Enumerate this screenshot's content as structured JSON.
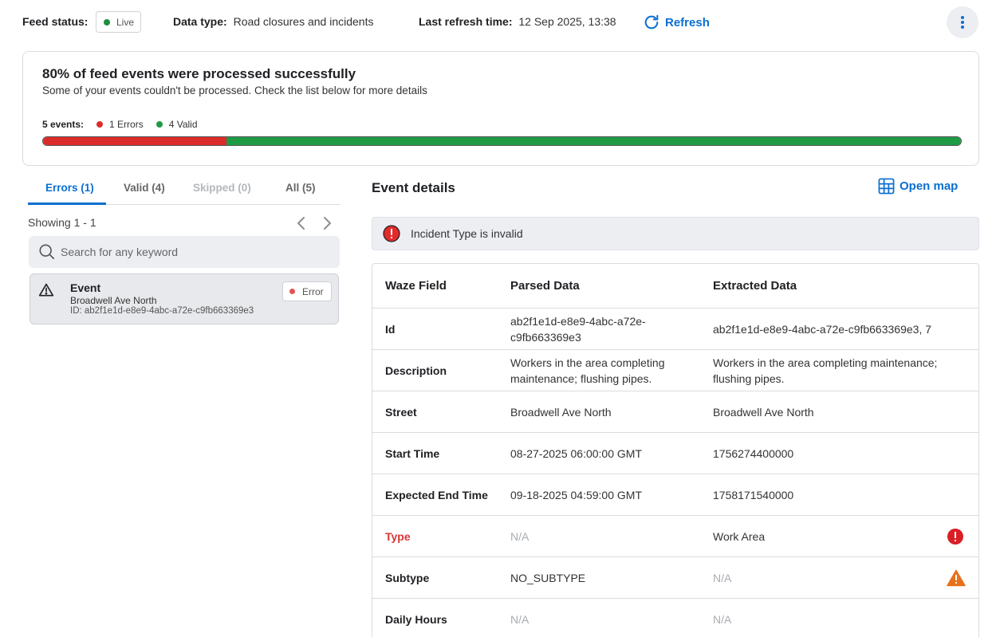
{
  "topbar": {
    "feed_status_label": "Feed status:",
    "feed_status_value": "Live",
    "data_type_label": "Data type:",
    "data_type_value": "Road closures and incidents",
    "last_refresh_label": "Last refresh time:",
    "last_refresh_value": "12 Sep 2025, 13:38",
    "refresh_label": "Refresh"
  },
  "summary": {
    "title": "80% of feed events were processed successfully",
    "subtitle": "Some of your events couldn't be processed. Check the list below for more details",
    "events_label": "5 events:",
    "errors_label": "1 Errors",
    "valid_label": "4 Valid",
    "error_fraction": 0.2,
    "error_color": "#dc2b2b",
    "valid_color": "#1f9a45"
  },
  "tabs": [
    {
      "label": "Errors (1)",
      "state": "active"
    },
    {
      "label": "Valid (4)",
      "state": "normal"
    },
    {
      "label": "Skipped (0)",
      "state": "disabled"
    },
    {
      "label": "All (5)",
      "state": "normal"
    }
  ],
  "list": {
    "showing": "Showing 1 - 1",
    "search_placeholder": "Search for any keyword",
    "events": [
      {
        "title": "Event",
        "street": "Broadwell Ave North",
        "id_text": "ID: ab2f1e1d-e8e9-4abc-a72e-c9fb663369e3",
        "badge": "Error"
      }
    ]
  },
  "details": {
    "title": "Event details",
    "open_map_label": "Open map",
    "alert_text": "Incident Type is invalid",
    "columns": [
      "Waze Field",
      "Parsed Data",
      "Extracted Data"
    ],
    "rows": [
      {
        "field": "Id",
        "parsed": "ab2f1e1d-e8e9-4abc-a72e-c9fb663369e3",
        "extracted": "ab2f1e1d-e8e9-4abc-a72e-c9fb663369e3, 7",
        "status": ""
      },
      {
        "field": "Description",
        "parsed": "Workers in the area completing maintenance; flushing pipes.",
        "extracted": "Workers in the area completing maintenance; flushing pipes.",
        "status": ""
      },
      {
        "field": "Street",
        "parsed": "Broadwell Ave North",
        "extracted": "Broadwell Ave North",
        "status": ""
      },
      {
        "field": "Start Time",
        "parsed": "08-27-2025 06:00:00 GMT",
        "extracted": "1756274400000",
        "status": ""
      },
      {
        "field": "Expected End Time",
        "parsed": "09-18-2025 04:59:00 GMT",
        "extracted": "1758171540000",
        "status": ""
      },
      {
        "field": "Type",
        "parsed": "N/A",
        "extracted": "Work Area",
        "status": "error"
      },
      {
        "field": "Subtype",
        "parsed": "NO_SUBTYPE",
        "extracted": "N/A",
        "status": "warning"
      },
      {
        "field": "Daily Hours",
        "parsed": "N/A",
        "extracted": "N/A",
        "status": ""
      }
    ]
  }
}
